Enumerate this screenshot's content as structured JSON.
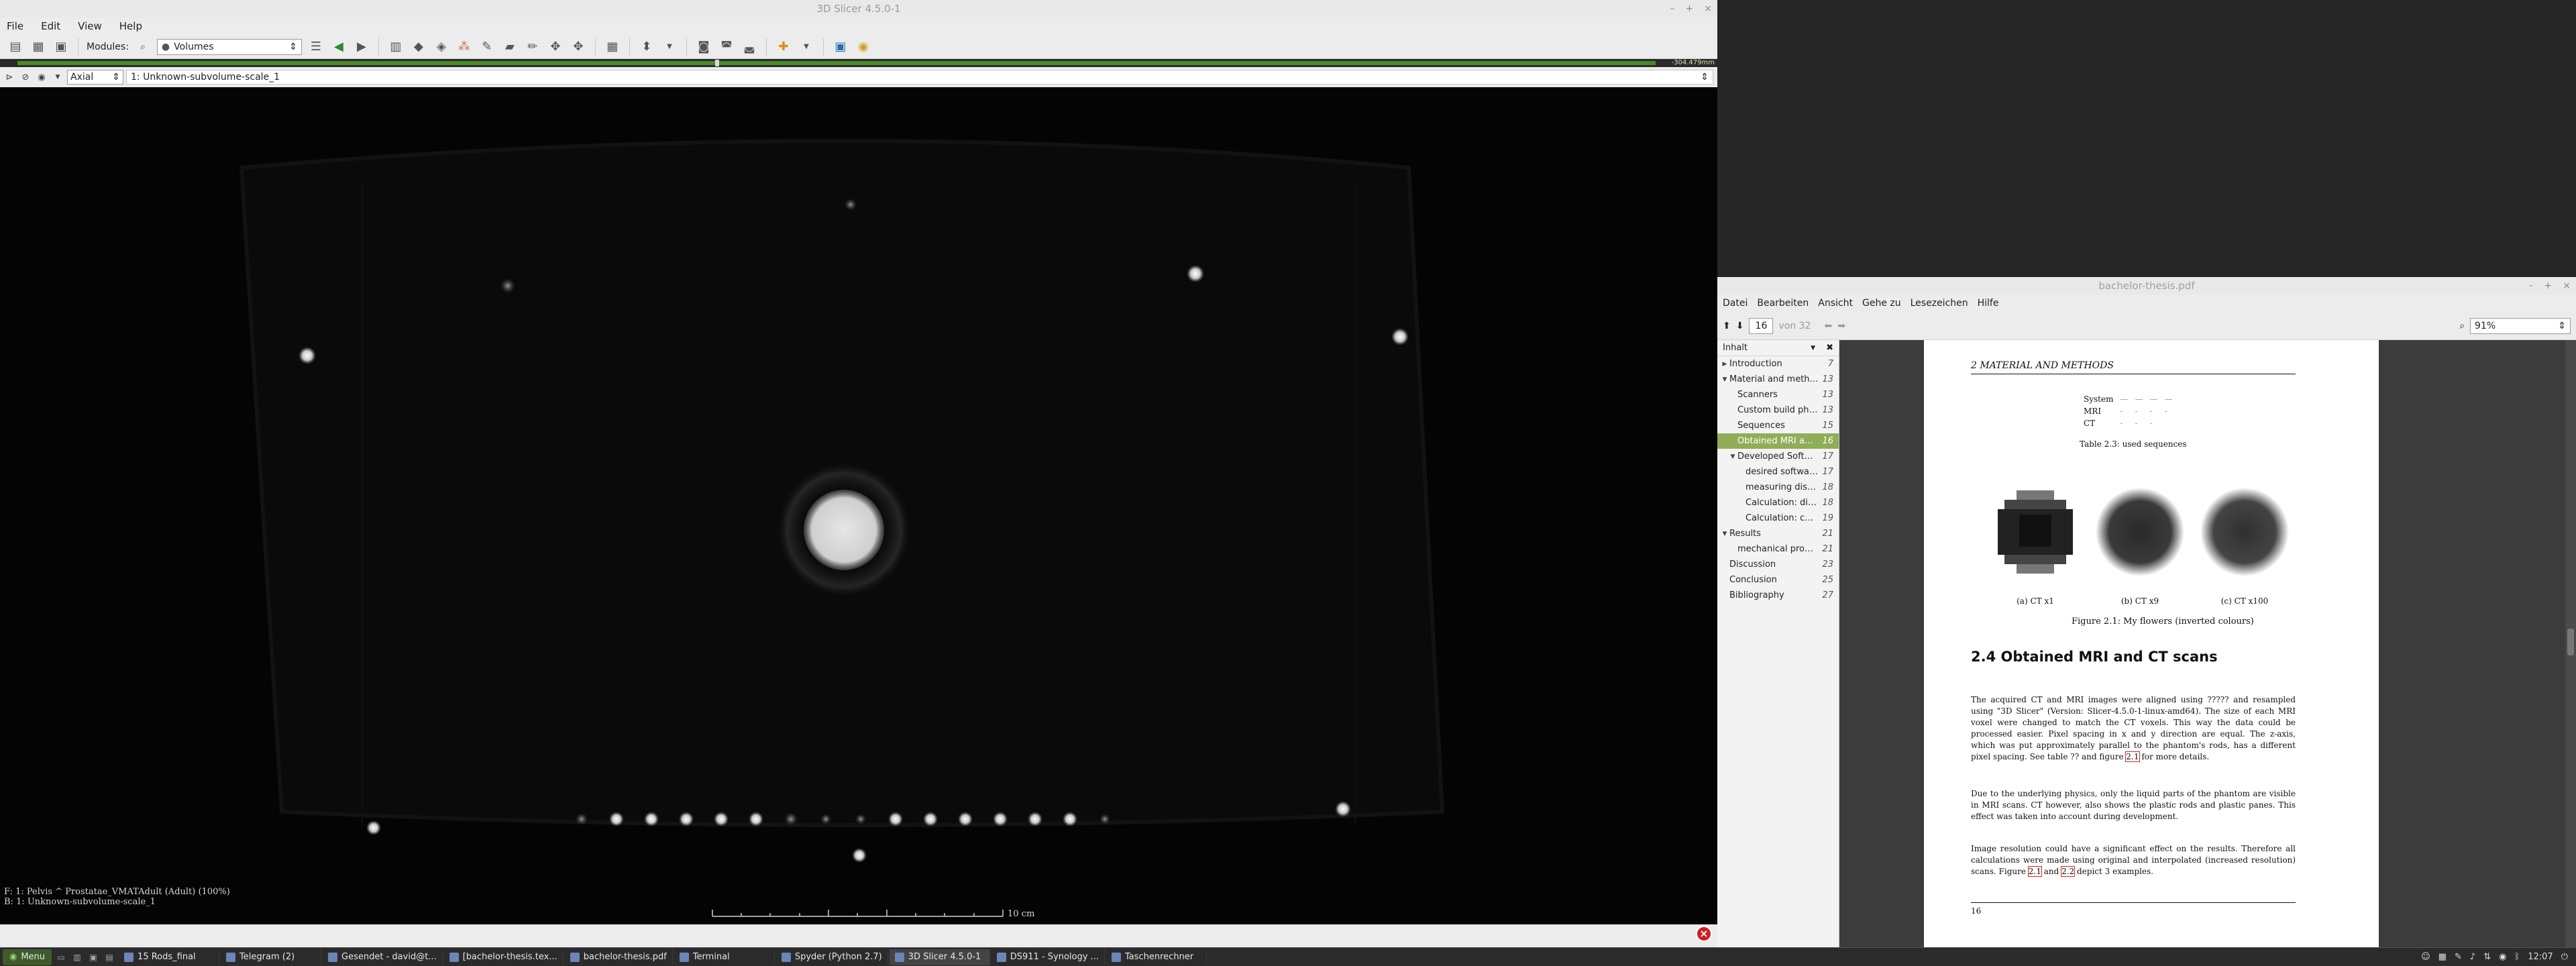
{
  "slicer": {
    "title": "3D Slicer 4.5.0-1",
    "menu": [
      "File",
      "Edit",
      "View",
      "Help"
    ],
    "modules_label": "Modules:",
    "module_selected": "Volumes",
    "slider_value": "-304.479mm",
    "controller": {
      "orientation": "Axial",
      "volume": "1: Unknown-subvolume-scale_1"
    },
    "overlay": {
      "fg": "F: 1: Pelvis ^ Prostatae_VMATAdult (Adult) (100%)",
      "bg": "B: 1: Unknown-subvolume-scale_1"
    },
    "scale_bar_label": "10 cm"
  },
  "pdf": {
    "title": "bachelor-thesis.pdf",
    "menu": [
      "Datei",
      "Bearbeiten",
      "Ansicht",
      "Gehe zu",
      "Lesezeichen",
      "Hilfe"
    ],
    "page_current": "16",
    "page_total": "von 32",
    "zoom": "91%",
    "toc_header": "Inhalt",
    "toc": [
      {
        "label": "Introduction",
        "page": "7",
        "level": 0,
        "toggle": "▶"
      },
      {
        "label": "Material and methods",
        "page": "13",
        "level": 0,
        "toggle": "▼"
      },
      {
        "label": "Scanners",
        "page": "13",
        "level": 1,
        "toggle": ""
      },
      {
        "label": "Custom build phant...",
        "page": "13",
        "level": 1,
        "toggle": ""
      },
      {
        "label": "Sequences",
        "page": "15",
        "level": 1,
        "toggle": ""
      },
      {
        "label": "Obtained MRI and C...",
        "page": "16",
        "level": 1,
        "toggle": "",
        "selected": true
      },
      {
        "label": "Developed Softwar...",
        "page": "17",
        "level": 1,
        "toggle": "▼"
      },
      {
        "label": "desired software ...",
        "page": "17",
        "level": 2,
        "toggle": ""
      },
      {
        "label": "measuring distort...",
        "page": "18",
        "level": 2,
        "toggle": ""
      },
      {
        "label": "Calculation: dice ...",
        "page": "18",
        "level": 2,
        "toggle": ""
      },
      {
        "label": "Calculation: cente...",
        "page": "19",
        "level": 2,
        "toggle": ""
      },
      {
        "label": "Results",
        "page": "21",
        "level": 0,
        "toggle": "▼"
      },
      {
        "label": "mechanical properti...",
        "page": "21",
        "level": 1,
        "toggle": ""
      },
      {
        "label": "Discussion",
        "page": "23",
        "level": 0,
        "toggle": ""
      },
      {
        "label": "Conclusion",
        "page": "25",
        "level": 0,
        "toggle": ""
      },
      {
        "label": "Bibliography",
        "page": "27",
        "level": 0,
        "toggle": ""
      }
    ],
    "page": {
      "running_head": "2  MATERIAL AND METHODS",
      "table_rows": [
        [
          "System",
          "—",
          "—",
          "—",
          "—"
        ],
        [
          "MRI",
          "-",
          "-",
          "-",
          "-"
        ],
        [
          "CT",
          "-",
          "-",
          "-",
          ""
        ]
      ],
      "table_caption": "Table 2.3: used sequences",
      "subfig_captions": [
        "(a) CT x1",
        "(b) CT x9",
        "(c) CT x100"
      ],
      "figure_caption": "Figure 2.1: My flowers (inverted colours)",
      "section_title": "2.4  Obtained MRI and CT scans",
      "para1_a": "The acquired CT and MRI images were aligned using ????? and resampled using \"3D Slicer\" (Version: Slicer-4.5.0-1-linux-amd64). The size of each MRI voxel were changed to match the CT voxels. This way the data could be processed easier. Pixel spacing in x and y direction are equal. The z-axis, which was put approximately parallel to the phantom's rods, has a different pixel spacing. See table ?? and figure ",
      "para1_ref": "2.1",
      "para1_b": " for more details.",
      "para2": "Due to the underlying physics, only the liquid parts of the phantom are visible in MRI scans. CT however, also shows the plastic rods and plastic panes. This effect was taken into account during development.",
      "para3_a": "Image resolution could have a significant effect on the results. Therefore all calculations were made using original and interpolated (increased resolution) scans. Figure ",
      "para3_ref1": "2.1",
      "para3_mid": " and ",
      "para3_ref2": "2.2",
      "para3_b": " depict 3 examples.",
      "page_number": "16"
    }
  },
  "taskbar": {
    "menu_label": "Menu",
    "items": [
      {
        "label": "15 Rods_final",
        "active": false
      },
      {
        "label": "Telegram (2)",
        "active": false
      },
      {
        "label": "Gesendet - david@t...",
        "active": false
      },
      {
        "label": "[bachelor-thesis.tex...",
        "active": false
      },
      {
        "label": "bachelor-thesis.pdf",
        "active": false
      },
      {
        "label": "Terminal",
        "active": false
      },
      {
        "label": "Spyder (Python 2.7)",
        "active": false
      },
      {
        "label": "3D Slicer 4.5.0-1",
        "active": true
      },
      {
        "label": "DS911 - Synology ...",
        "active": false
      },
      {
        "label": "Taschenrechner",
        "active": false
      }
    ],
    "clock": "12:07"
  }
}
